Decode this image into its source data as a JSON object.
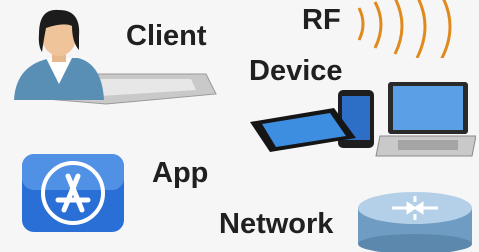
{
  "labels": {
    "client": "Client",
    "rf": "RF",
    "device": "Device",
    "app": "App",
    "network": "Network"
  },
  "icons": {
    "client": "person-with-laptop-icon",
    "rf": "radio-waves-icon",
    "devices": "tablet-phone-laptop-icon",
    "app": "app-store-icon",
    "network": "router-icon"
  },
  "colors": {
    "background": "#f6f6f6",
    "text": "#202020",
    "waves": "#e08a1e",
    "app_blue": "#2a6fd6",
    "router": "#8fb8d8"
  }
}
